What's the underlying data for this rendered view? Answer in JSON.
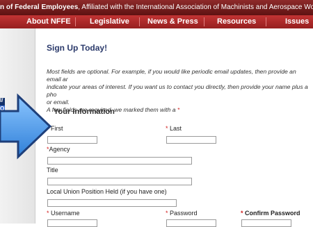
{
  "banner": {
    "text_start": "n of Federal Employees",
    "text_rest": ", Affiliated with the International Association of Machinists and Aerospace Workers, A"
  },
  "nav": {
    "items": [
      "About NFFE",
      "Legislative",
      "News & Press",
      "Resources",
      "Issues"
    ]
  },
  "sidebar": {
    "fragment_1": "l/",
    "fragment_2": "O"
  },
  "form": {
    "title": "Sign Up Today!",
    "intro_line1": "Most fields are optional. For example, if you would like periodic email updates, then provide an email ar",
    "intro_line2": "indicate your areas of interest. If you want us to contact you directly, then provide your name plus a pho",
    "intro_line3": "or email.",
    "intro_line4": "A few fields are required, we marked them with a",
    "required_mark": "*",
    "section_heading": "Your Information",
    "labels": {
      "first": "First",
      "last": "Last",
      "agency": "Agency",
      "title": "Title",
      "local_union": "Local Union Position Held (if you have one)",
      "username": "Username",
      "password": "Password",
      "confirm_password": "Confirm Password"
    },
    "values": {
      "first": "",
      "last": "",
      "agency": "",
      "title": "",
      "local_union": "",
      "username": "",
      "password": "",
      "confirm_password": ""
    }
  },
  "colors": {
    "banner_bg": "#6e1a1a",
    "nav_bg": "#b52828",
    "title_color": "#2b3a6b",
    "required_color": "#d01e1e",
    "arrow_fill": "#4a9be8"
  },
  "icons": {
    "pointer_arrow": "right-arrow-icon"
  }
}
